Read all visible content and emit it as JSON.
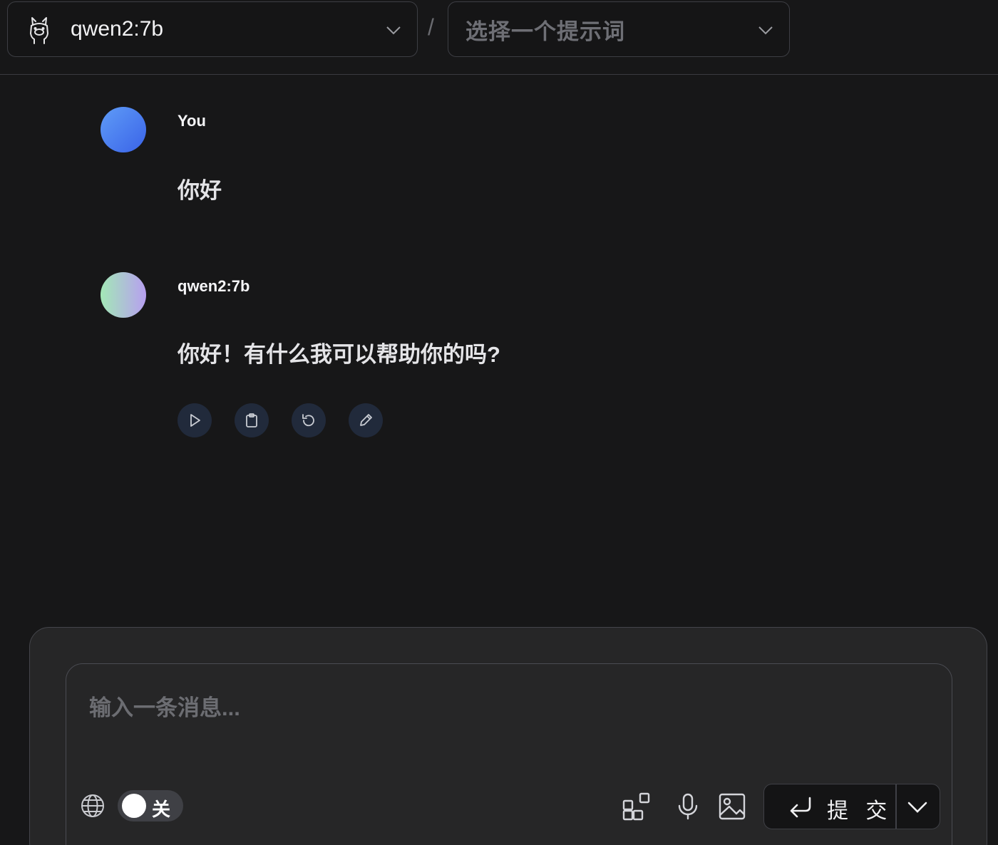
{
  "header": {
    "model_select": {
      "value": "qwen2:7b",
      "icon": "llama-icon"
    },
    "separator": "/",
    "prompt_select": {
      "placeholder": "选择一个提示词"
    }
  },
  "messages": [
    {
      "role": "user",
      "author": "You",
      "text": "你好"
    },
    {
      "role": "assistant",
      "author": "qwen2:7b",
      "text": "你好！有什么我可以帮助你的吗?",
      "actions": [
        "play-icon",
        "clipboard-icon",
        "regenerate-icon",
        "edit-icon"
      ]
    }
  ],
  "composer": {
    "placeholder": "输入一条消息...",
    "web_search_toggle": {
      "label": "关",
      "state": "off"
    },
    "submit_label": "提 交"
  },
  "colors": {
    "background": "#171718",
    "composer_bg": "#262627",
    "action_bg": "#212a3b",
    "user_avatar": "#4a7cf0"
  }
}
